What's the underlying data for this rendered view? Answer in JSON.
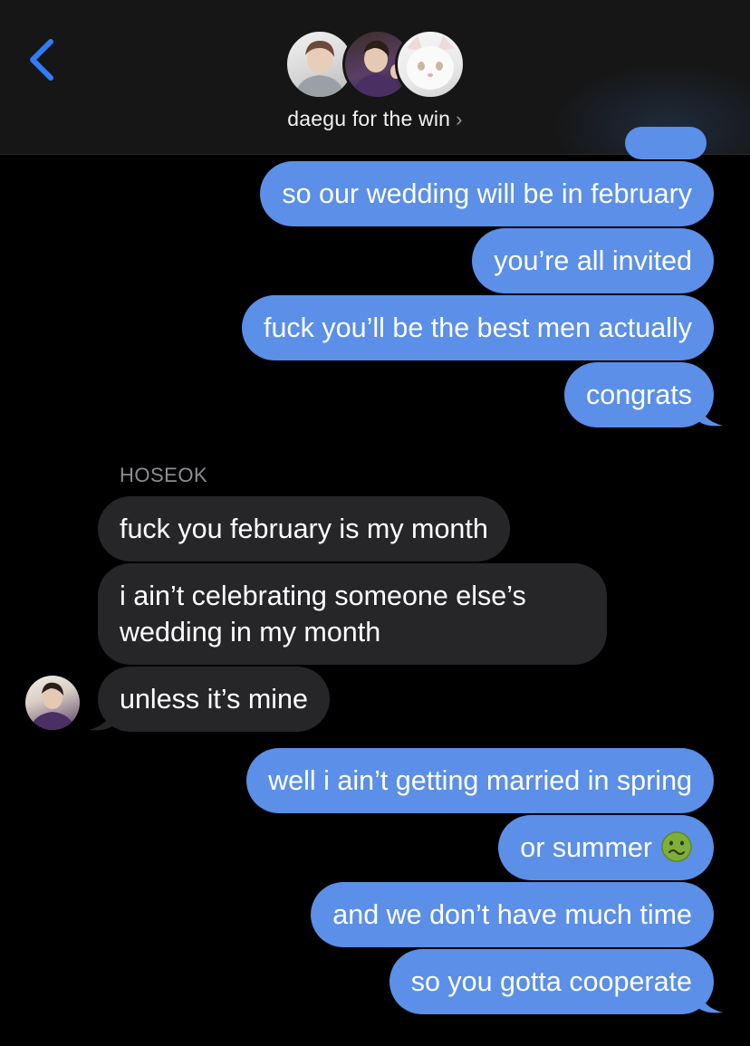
{
  "header": {
    "back_icon": "chevron-left-icon",
    "group_name": "daegu for the win",
    "chevron": "›",
    "avatar_count": 3
  },
  "messages": {
    "out_1": "so our wedding will be in february",
    "out_2": "you’re all invited",
    "out_3": "fuck you’ll be the best men actually",
    "out_4": "congrats",
    "sender_name": "HOSEOK",
    "in_1": "fuck you february is my month",
    "in_2": "i ain’t celebrating someone else’s wedding in my month",
    "in_3": "unless it’s mine",
    "out_5": "well i ain’t getting married in spring",
    "out_6": "or summer",
    "out_6_emoji": "nauseated-face-icon",
    "out_7": "and we don’t have much time",
    "out_8": "so you gotta cooperate"
  },
  "colors": {
    "outgoing_bubble": "#5b8fe8",
    "incoming_bubble": "#262628",
    "background": "#000000",
    "accent": "#2f7cf6"
  }
}
